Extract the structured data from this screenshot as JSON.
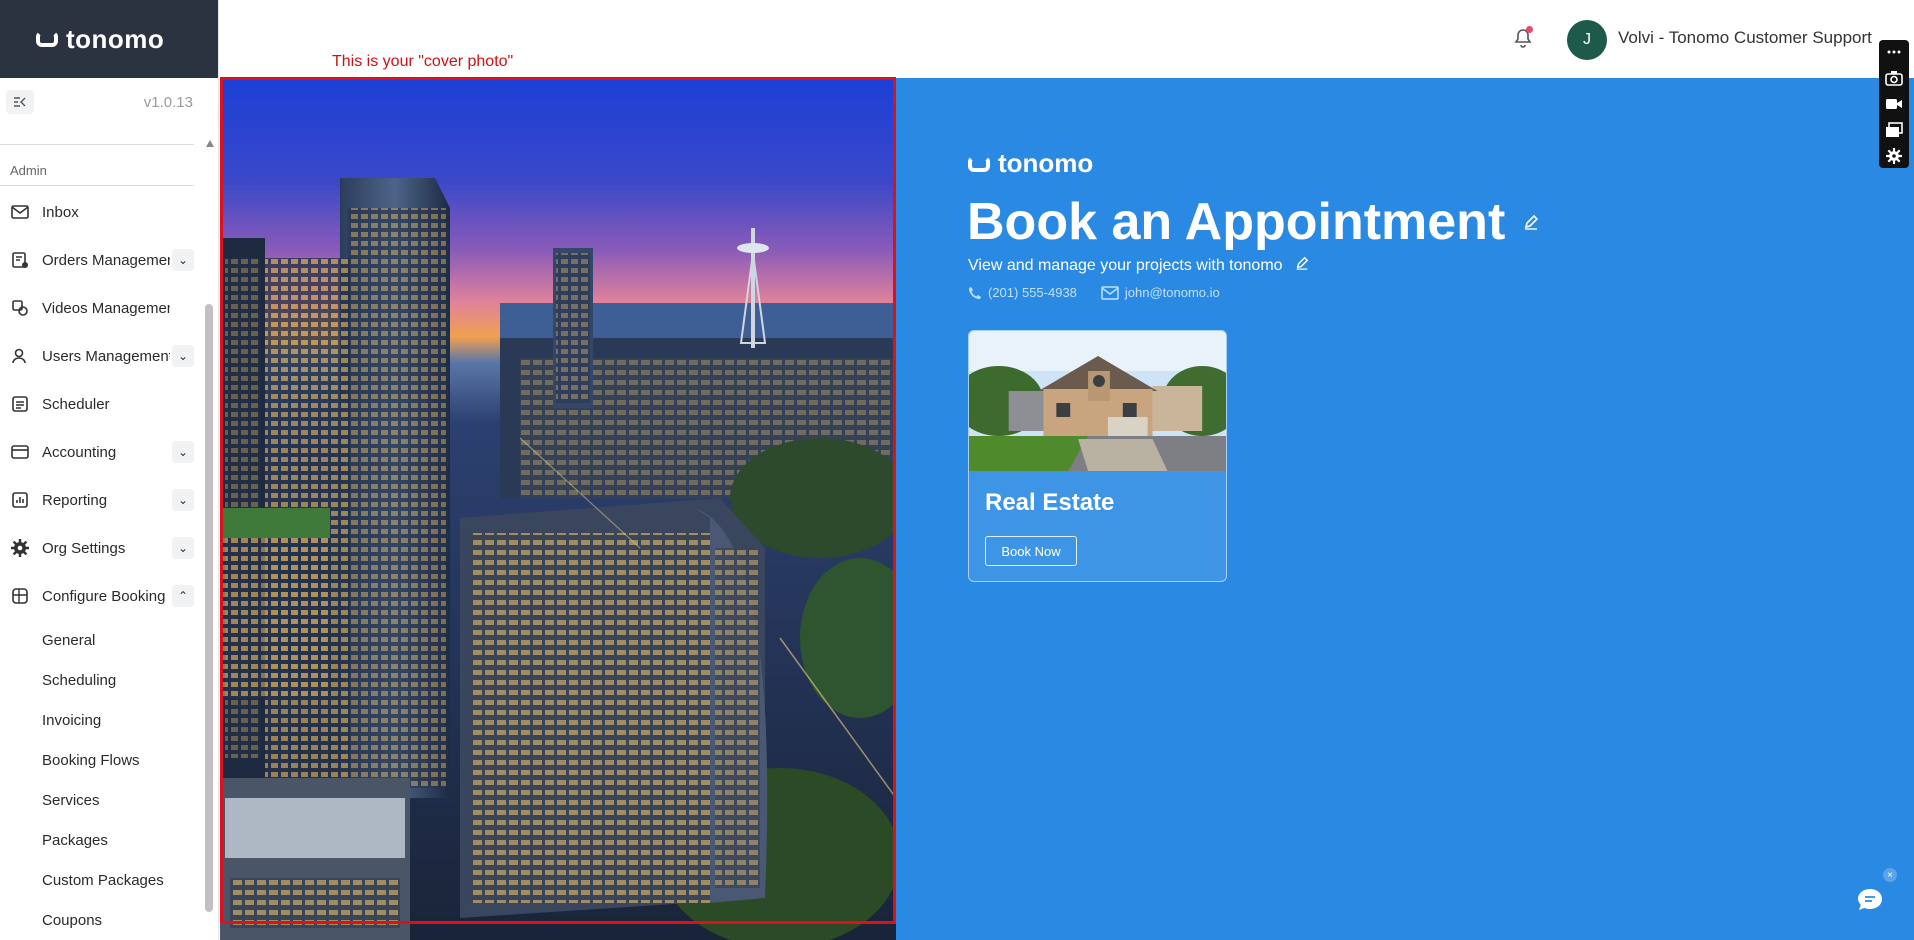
{
  "brand": {
    "name": "tonomo"
  },
  "sidebar": {
    "version": "v1.0.13",
    "section_label": "Admin",
    "items": [
      {
        "label": "Inbox",
        "icon": "inbox-icon",
        "expandable": false
      },
      {
        "label": "Orders Management",
        "icon": "orders-icon",
        "expandable": true
      },
      {
        "label": "Videos Management",
        "icon": "video-icon",
        "expandable": false
      },
      {
        "label": "Users Management",
        "icon": "users-icon",
        "expandable": true
      },
      {
        "label": "Scheduler",
        "icon": "scheduler-icon",
        "expandable": false
      },
      {
        "label": "Accounting",
        "icon": "wallet-icon",
        "expandable": true
      },
      {
        "label": "Reporting",
        "icon": "report-icon",
        "expandable": true
      },
      {
        "label": "Org Settings",
        "icon": "gear-icon",
        "expandable": true
      },
      {
        "label": "Configure Booking",
        "icon": "booking-icon",
        "expandable": true,
        "expanded": true
      }
    ],
    "sub_items": [
      "General",
      "Scheduling",
      "Invoicing",
      "Booking Flows",
      "Services",
      "Packages",
      "Custom Packages",
      "Coupons"
    ]
  },
  "header": {
    "avatar_initial": "J",
    "user_name": "Volvi - Tonomo Customer Support"
  },
  "annotation": {
    "cover_note": "This is your \"cover photo\""
  },
  "booking": {
    "logo_text": "tonomo",
    "title": "Book an Appointment",
    "subtitle": "View and manage your projects with tonomo",
    "phone": "(201) 555-4938",
    "email": "john@tonomo.io",
    "card": {
      "title": "Real Estate",
      "button": "Book Now"
    }
  },
  "colors": {
    "panel_blue": "#2a8ae3",
    "brand_dark": "#2b3240",
    "annotation_red": "#e0101a",
    "avatar_green": "#1e5a49"
  }
}
